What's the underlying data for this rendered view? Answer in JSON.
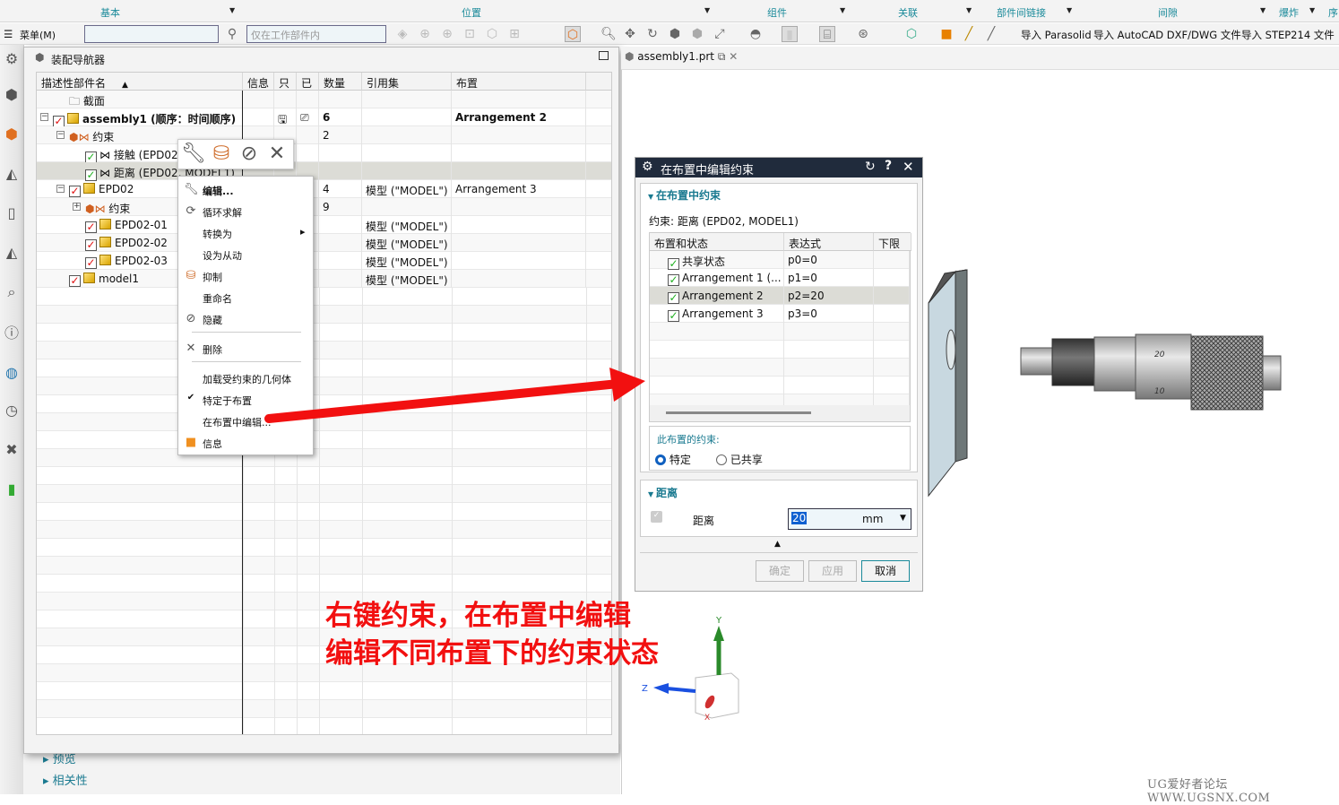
{
  "ribbon": {
    "groups": [
      "基本",
      "位置",
      "组件",
      "关联",
      "部件间链接",
      "间隙",
      "爆炸",
      "序"
    ]
  },
  "toolbar": {
    "menu_label": "菜单(M)",
    "filter_placeholder": "",
    "scope_select": "仅在工作部件内",
    "imports": [
      "导入 Parasolid",
      "导入 AutoCAD DXF/DWG 文件",
      "导入 STEP214 文件"
    ]
  },
  "leftbar": {
    "icons": [
      "gear-icon",
      "part-navigator-icon",
      "assembly-navigator-icon",
      "constraint-navigator-icon",
      "reuse-library-icon",
      "pmi-navigator-icon",
      "measure-icon",
      "history-icon",
      "web-browser-icon",
      "clock-icon",
      "tools-icon",
      "color-palette-icon"
    ]
  },
  "navigator": {
    "title": "装配导航器",
    "columns": [
      "描述性部件名",
      "信息",
      "只",
      "已",
      "数量",
      "引用集",
      "布置"
    ],
    "rows": [
      {
        "name": "截面",
        "qty": "",
        "refset": "",
        "arr": ""
      },
      {
        "name": "assembly1 (顺序：时间顺序)",
        "qty": "6",
        "refset": "",
        "arr": "Arrangement 2"
      },
      {
        "name": "约束",
        "qty": "2",
        "refset": "",
        "arr": ""
      },
      {
        "name": "接触 (EPD02",
        "qty": "",
        "refset": "",
        "arr": ""
      },
      {
        "name": "距离 (EPD02, MODEL1)",
        "qty": "",
        "refset": "",
        "arr": ""
      },
      {
        "name": "EPD02",
        "qty": "4",
        "refset": "模型 (\"MODEL\")",
        "arr": "Arrangement 3"
      },
      {
        "name": "约束",
        "qty": "9",
        "refset": "",
        "arr": ""
      },
      {
        "name": "EPD02-01",
        "qty": "",
        "refset": "模型 (\"MODEL\")",
        "arr": ""
      },
      {
        "name": "EPD02-02",
        "qty": "",
        "refset": "模型 (\"MODEL\")",
        "arr": ""
      },
      {
        "name": "EPD02-03",
        "qty": "",
        "refset": "模型 (\"MODEL\")",
        "arr": ""
      },
      {
        "name": "model1",
        "qty": "",
        "refset": "模型 (\"MODEL\")",
        "arr": ""
      }
    ],
    "bottom_sections": [
      "预览",
      "相关性"
    ]
  },
  "context_menu": {
    "items": [
      "编辑...",
      "循环求解",
      "转换为",
      "设为从动",
      "抑制",
      "重命名",
      "隐藏",
      "删除",
      "加载受约束的几何体",
      "特定于布置",
      "在布置中编辑...",
      "信息"
    ]
  },
  "graphics_tab": {
    "label": "assembly1.prt"
  },
  "dialog": {
    "title": "在布置中编辑约束",
    "section1": "在布置中约束",
    "constraint_label": "约束: 距离 (EPD02, MODEL1)",
    "table_columns": [
      "布置和状态",
      "表达式",
      "下限"
    ],
    "table_rows": [
      {
        "name": "共享状态",
        "expr": "p0=0"
      },
      {
        "name": "Arrangement 1 (...",
        "expr": "p1=0"
      },
      {
        "name": "Arrangement 2",
        "expr": "p2=20"
      },
      {
        "name": "Arrangement 3",
        "expr": "p3=0"
      }
    ],
    "this_arr_label": "此布置的约束:",
    "radio_specific": "特定",
    "radio_shared": "已共享",
    "section2": "距离",
    "distance_label": "距离",
    "distance_value": "20",
    "distance_unit": "mm",
    "ok": "确定",
    "apply": "应用",
    "cancel": "取消"
  },
  "annotation": {
    "line1": "右键约束，在布置中编辑",
    "line2": "编辑不同布置下的约束状态",
    "color": "#f21010"
  },
  "triad": {
    "x": "X",
    "y": "Y",
    "z": "Z"
  },
  "watermark": "UG爱好者论坛 WWW.UGSNX.COM",
  "colors": {
    "accent": "#1a8a9a",
    "dialog_title_bg": "#202b3c",
    "arrow": "#f21010"
  }
}
